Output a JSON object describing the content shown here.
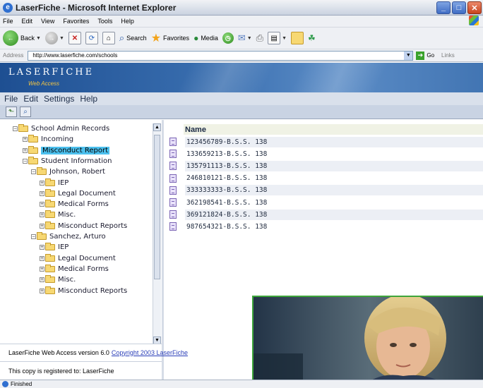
{
  "window": {
    "title": "LaserFiche - Microsoft Internet Explorer",
    "controls": [
      "minimize",
      "maximize",
      "close"
    ]
  },
  "ie_menu": [
    "File",
    "Edit",
    "View",
    "Favorites",
    "Tools",
    "Help"
  ],
  "ie_toolbar": {
    "back": "Back",
    "search": "Search",
    "favorites": "Favorites",
    "media": "Media"
  },
  "address_bar": {
    "label": "Address",
    "url": "http://www.laserfiche.com/schools",
    "go": "Go",
    "links": "Links"
  },
  "banner": {
    "logo": "LASERFICHE",
    "subtitle": "Web Access"
  },
  "app_menu": [
    "File",
    "Edit",
    "Settings",
    "Help"
  ],
  "tree": {
    "items": [
      {
        "label": "School Admin Records",
        "level": 0,
        "expanded": true,
        "selected": false
      },
      {
        "label": "Incoming",
        "level": 1,
        "expanded": false,
        "selected": false
      },
      {
        "label": "Misconduct Report",
        "level": 1,
        "expanded": false,
        "selected": true
      },
      {
        "label": "Student Information",
        "level": 1,
        "expanded": true,
        "selected": false
      },
      {
        "label": "Johnson, Robert",
        "level": 2,
        "expanded": true,
        "selected": false
      },
      {
        "label": "IEP",
        "level": 3,
        "expanded": false,
        "selected": false
      },
      {
        "label": "Legal Document",
        "level": 3,
        "expanded": false,
        "selected": false
      },
      {
        "label": "Medical Forms",
        "level": 3,
        "expanded": false,
        "selected": false
      },
      {
        "label": "Misc.",
        "level": 3,
        "expanded": false,
        "selected": false
      },
      {
        "label": "Misconduct Reports",
        "level": 3,
        "expanded": false,
        "selected": false
      },
      {
        "label": "Sanchez, Arturo",
        "level": 2,
        "expanded": true,
        "selected": false
      },
      {
        "label": "IEP",
        "level": 3,
        "expanded": false,
        "selected": false
      },
      {
        "label": "Legal Document",
        "level": 3,
        "expanded": false,
        "selected": false
      },
      {
        "label": "Medical Forms",
        "level": 3,
        "expanded": false,
        "selected": false
      },
      {
        "label": "Misc.",
        "level": 3,
        "expanded": false,
        "selected": false
      },
      {
        "label": "Misconduct Reports",
        "level": 3,
        "expanded": false,
        "selected": false
      }
    ]
  },
  "document_list": {
    "header": "Name",
    "rows": [
      "123456789-B.S.S. 138",
      "133659213-B.S.S. 138",
      "135791113-B.S.S. 138",
      "246810121-B.S.S. 138",
      "333333333-B.S.S. 138",
      "362198541-B.S.S. 138",
      "369121824-B.S.S. 138",
      "987654321-B.S.S. 138"
    ]
  },
  "footer": {
    "version_text": "LaserFiche Web Access version 6.0",
    "copyright_link": "Copyright 2003 LaserFiche",
    "registered_text": "This copy is registered to: LaserFiche"
  },
  "status": "Finished"
}
